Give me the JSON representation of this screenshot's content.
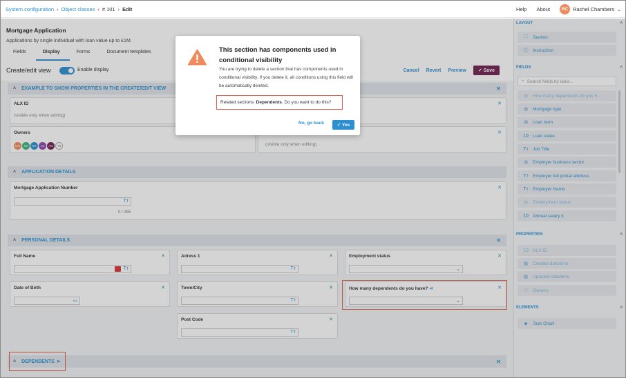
{
  "breadcrumb": {
    "items": [
      "System configuration",
      "Object classes",
      "# 101"
    ],
    "current": "Edit"
  },
  "topnav": {
    "help": "Help",
    "about": "About",
    "user_initials": "RC",
    "user_name": "Rachel Chambers"
  },
  "header": {
    "title": "Mortgage Application",
    "description": "Applications by single individual with loan value up to £1M.",
    "tabs": [
      "Fields",
      "Display",
      "Forms",
      "Document templates"
    ],
    "active_tab": "Display"
  },
  "toolbar": {
    "view_label": "Create/edit view",
    "toggle_label": "Enable display",
    "cancel": "Cancel",
    "revert": "Revert",
    "preview": "Preview",
    "save": "Save"
  },
  "sections": {
    "example": {
      "title": "EXAMPLE TO SHOW PROPERTIES IN THE CREATE/EDIT VIEW",
      "alx_label": "ALX ID",
      "alx_sub": "(visible only when editing)",
      "owners_label": "Owners",
      "owners_avatars": [
        "MO",
        "SD",
        "KR",
        "AK",
        "AO"
      ],
      "owners_more": "+5",
      "right_sub": "(visible only when editing)"
    },
    "application": {
      "title": "APPLICATION DETAILS",
      "field_label": "Mortgage Application Number",
      "counter": "0 / 255"
    },
    "personal": {
      "title": "PERSONAL DETAILS",
      "full_name": "Full Name",
      "address": "Adress 1",
      "employment": "Employment status",
      "dob": "Date of Birth",
      "town": "Town/City",
      "dependents_q": "How many dependents do you have?",
      "post_code": "Post Code"
    },
    "dependents": {
      "title": "DEPENDENTS"
    }
  },
  "modal": {
    "title": "This section has components used in conditional visibility",
    "body": "You are trying to delete a section that has components used in conditional visibility. If you delete it, all conditions using this field will be automatically deleted.",
    "related_prefix": "Related sections: ",
    "related_name": "Dependents",
    "related_suffix": ". Do you want to do this?",
    "no_label": "No, go back",
    "yes_label": "Yes"
  },
  "panel": {
    "layout_title": "LAYOUT",
    "layout_items": [
      {
        "icon": "section-icon",
        "label": "Section"
      },
      {
        "icon": "info-icon",
        "label": "Instruction"
      }
    ],
    "fields_title": "FIELDS",
    "search_placeholder": "Search fields by label...",
    "fields_items": [
      {
        "icon": "select-icon",
        "label": "How many dependents do you h...",
        "dim": true
      },
      {
        "icon": "select-icon",
        "label": "Mortgage type",
        "dim": false
      },
      {
        "icon": "select-icon",
        "label": "Loan term",
        "dim": false
      },
      {
        "icon": "number-icon",
        "label": "Loan value",
        "dim": false
      },
      {
        "icon": "text-icon",
        "label": "Job Title",
        "dim": false
      },
      {
        "icon": "select-icon",
        "label": "Employer business sector",
        "dim": false
      },
      {
        "icon": "text-icon",
        "label": "Employer full postal address",
        "dim": false
      },
      {
        "icon": "text-icon",
        "label": "Employer Name",
        "dim": false
      },
      {
        "icon": "select-icon",
        "label": "Employment status",
        "dim": true
      },
      {
        "icon": "number-icon",
        "label": "Annual salary £",
        "dim": false
      }
    ],
    "properties_title": "PROPERTIES",
    "properties_items": [
      {
        "icon": "number-icon",
        "label": "ALX ID"
      },
      {
        "icon": "calendar-icon",
        "label": "Created date/time"
      },
      {
        "icon": "calendar-icon",
        "label": "Updated date/time"
      },
      {
        "icon": "person-icon",
        "label": "Owners"
      }
    ],
    "elements_title": "ELEMENTS",
    "elements_items": [
      {
        "icon": "chart-icon",
        "label": "Task Chart"
      }
    ]
  },
  "colors": {
    "accent": "#2b8fd1",
    "save": "#6f1f4f",
    "highlight": "#e05a47",
    "warning": "#f08a5d"
  }
}
